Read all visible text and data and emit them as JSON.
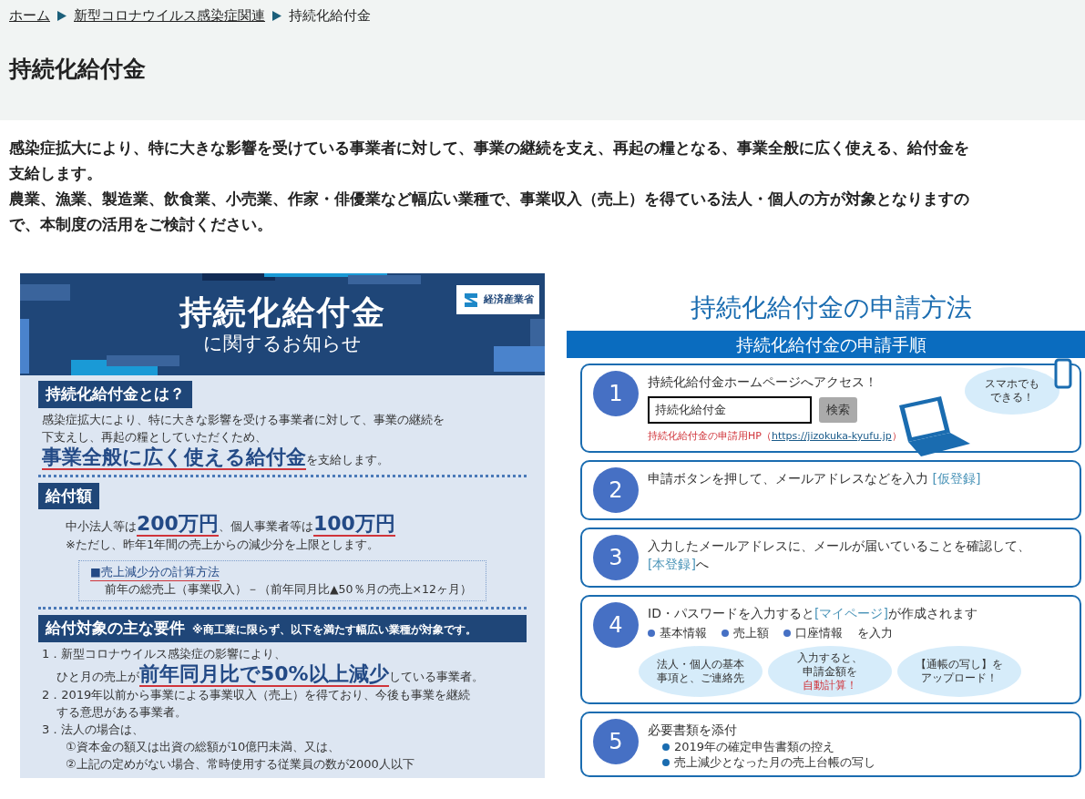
{
  "breadcrumb": [
    {
      "label": "ホーム",
      "link": true
    },
    {
      "label": "新型コロナウイルス感染症関連",
      "link": true
    },
    {
      "label": "持続化給付金",
      "link": false
    }
  ],
  "title": "持続化給付金",
  "intro": [
    [
      "感染症拡大により、特に大きな影響を受けている事業者に対して、事業の継続を支え、再起の糧となる、事業全般に広く使える、給付金を",
      "支給します。"
    ],
    [
      "農業、漁業、製造業、飲食業、小売業、作家・俳優業など幅広い業種で、事業収入（売上）を得ている法人・個人の方が対象となりますの",
      "で、本制度の活用をご検討ください。"
    ]
  ],
  "notice_flyer": {
    "title": "持続化給付金",
    "subtitle": "に関するお知らせ",
    "logo": "経済産業省",
    "sections": [
      {
        "heading": "持続化給付金とは？",
        "lines": [
          {
            "kind": "item",
            "segments": [
              {
                "text": "感染症拡大により、特に大きな影響を受ける事業者に対して、事業の継続を",
                "emphasis": false
              }
            ]
          },
          {
            "kind": "item",
            "segments": [
              {
                "text": "下支えし、再起の糧としていただくため、",
                "emphasis": false
              }
            ]
          },
          {
            "kind": "item",
            "segments": [
              {
                "text": "事業全般に広く使える給付金",
                "emphasis": true
              },
              {
                "text": "を支給します。",
                "emphasis": false
              }
            ]
          }
        ]
      },
      {
        "heading": "給付額",
        "lines": [
          {
            "kind": "sub",
            "segments": [
              {
                "text": "中小法人等は",
                "emphasis": false
              },
              {
                "text": "200万円",
                "emphasis": true
              },
              {
                "text": "、個人事業者等は",
                "emphasis": false
              },
              {
                "text": "100万円",
                "emphasis": true
              }
            ]
          },
          {
            "kind": "sub",
            "segments": [
              {
                "text": "※ただし、昨年1年間の売上からの減少分を上限とします。",
                "emphasis": false
              }
            ]
          }
        ],
        "box": {
          "title": "■売上減少分の計算方法",
          "text": "前年の総売上（事業収入）－（前年同月比▲50％月の売上×12ヶ月）"
        }
      },
      {
        "heading": "給付対象の主な要件",
        "note": "※商工業に限らず、以下を満たす幅広い業種が対象です。",
        "lines": [
          {
            "kind": "item",
            "segments": [
              {
                "text": "1．新型コロナウイルス感染症の影響により、",
                "emphasis": false
              }
            ]
          },
          {
            "kind": "continuation",
            "segments": [
              {
                "text": "ひと月の売上が",
                "emphasis": false
              },
              {
                "text": "前年同月比で50%以上減少",
                "emphasis": true
              },
              {
                "text": "している事業者。",
                "emphasis": false
              }
            ]
          },
          {
            "kind": "item",
            "segments": [
              {
                "text": "2．2019年以前から事業による事業収入（売上）を得ており、今後も事業を継続",
                "emphasis": false
              }
            ]
          },
          {
            "kind": "continuation",
            "segments": [
              {
                "text": "する意思がある事業者。",
                "emphasis": false
              }
            ]
          },
          {
            "kind": "item",
            "segments": [
              {
                "text": "3．法人の場合は、",
                "emphasis": false
              }
            ]
          },
          {
            "kind": "sub",
            "segments": [
              {
                "text": "①資本金の額又は出資の総額が10億円未満、又は、",
                "emphasis": false
              }
            ]
          },
          {
            "kind": "sub",
            "segments": [
              {
                "text": "②上記の定めがない場合、常時使用する従業員の数が2000人以下",
                "emphasis": false
              }
            ]
          }
        ]
      }
    ]
  },
  "application_flyer": {
    "title": "持続化給付金の申請方法",
    "band": "持続化給付金の申請手順",
    "steps": [
      {
        "number": "1",
        "lines": [
          [
            {
              "text": "持続化給付金ホームページへアクセス！",
              "highlight": false
            }
          ]
        ],
        "search": {
          "value": "持続化給付金",
          "button": "検索",
          "caption": "持続化給付金の申請用HP（",
          "url": "https://jizokuka-kyufu.jp",
          "caption_end": "）",
          "bubble": [
            "スマホでも",
            "できる！"
          ]
        }
      },
      {
        "number": "2",
        "lines": [
          [
            {
              "text": "申請ボタンを押して、メールアドレスなどを入力 ",
              "highlight": false
            },
            {
              "text": "[仮登録]",
              "highlight": true
            }
          ]
        ]
      },
      {
        "number": "3",
        "lines": [
          [
            {
              "text": "入力したメールアドレスに、メールが届いていることを確認して、",
              "highlight": false
            }
          ],
          [
            {
              "text": "[本登録]",
              "highlight": true
            },
            {
              "text": "へ",
              "highlight": false
            }
          ]
        ]
      },
      {
        "number": "4",
        "lines": [
          [
            {
              "text": "ID・パスワードを入力すると",
              "highlight": false
            },
            {
              "text": "[マイページ]",
              "highlight": true
            },
            {
              "text": "が作成されます",
              "highlight": false
            }
          ]
        ],
        "inputs": {
          "items": [
            "基本情報",
            "売上額",
            "口座情報"
          ],
          "suffix": "を入力"
        },
        "bubbles": [
          [
            {
              "text": "法人・個人の基本",
              "alert": false
            },
            {
              "text": "事項と、ご連絡先",
              "alert": false
            }
          ],
          [
            {
              "text": "入力すると、",
              "alert": false
            },
            {
              "text": "申請金額を",
              "alert": false
            },
            {
              "text": "自動計算！",
              "alert": true
            }
          ],
          [
            {
              "text": "【通帳の写し】を",
              "alert": false
            },
            {
              "text": "アップロード！",
              "alert": false
            }
          ]
        ]
      },
      {
        "number": "5",
        "lines": [
          [
            {
              "text": "必要書類を添付",
              "highlight": false
            }
          ]
        ],
        "documents": [
          "2019年の確定申告書類の控え",
          "売上減少となった月の売上台帳の写し"
        ]
      }
    ]
  }
}
